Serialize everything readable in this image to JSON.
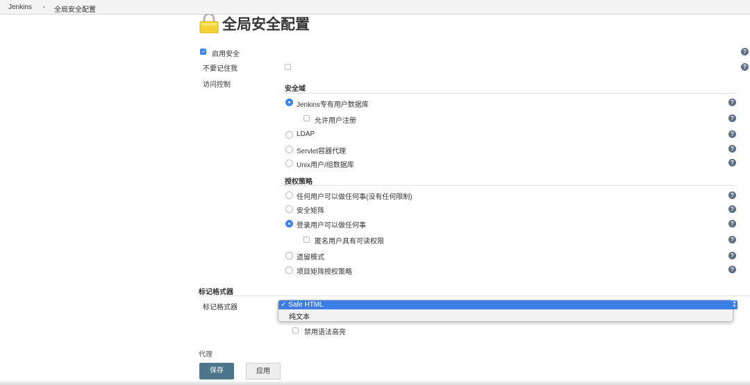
{
  "breadcrumb": {
    "root": "Jenkins",
    "current": "全局安全配置"
  },
  "title": "全局安全配置",
  "enable_security": {
    "label": "启用安全",
    "checked": true
  },
  "remember_me": {
    "label": "不要记住我",
    "checked": false
  },
  "access_control": {
    "label": "访问控制",
    "security_realm": {
      "heading": "安全域",
      "jenkins_db": {
        "label": "Jenkins专有用户数据库",
        "selected": true
      },
      "allow_signup": {
        "label": "允许用户注册",
        "checked": false
      },
      "ldap": {
        "label": "LDAP",
        "selected": false
      },
      "servlet": {
        "label": "Servlet容器代理",
        "selected": false
      },
      "unix": {
        "label": "Unix用户/组数据库",
        "selected": false
      }
    },
    "authorization": {
      "heading": "授权策略",
      "anyone": {
        "label": "任何用户可以做任何事(没有任何限制)",
        "selected": false
      },
      "matrix": {
        "label": "安全矩阵",
        "selected": false
      },
      "logged_in": {
        "label": "登录用户可以做任何事",
        "selected": true
      },
      "anon_read": {
        "label": "匿名用户具有可读权限",
        "checked": false
      },
      "legacy": {
        "label": "遗留模式",
        "selected": false
      },
      "project_matrix": {
        "label": "项目矩阵授权策略",
        "selected": false
      }
    }
  },
  "markup": {
    "section_title": "标记格式器",
    "label": "标记格式器",
    "selected": "✓ Safe HTML",
    "option_plain": "纯文本",
    "disable_syntax": {
      "label": "禁用语法高亮",
      "checked": false
    }
  },
  "proxy": {
    "label": "代理"
  },
  "buttons": {
    "save": "保存",
    "apply": "应用"
  },
  "icons": {
    "help": "help-icon",
    "lock": "lock-icon",
    "breadcrumb_separator": "chevron-right-icon"
  },
  "colors": {
    "accent": "#3b82f6",
    "save_button": "#4b758b",
    "help_icon": "#5d6f86"
  }
}
